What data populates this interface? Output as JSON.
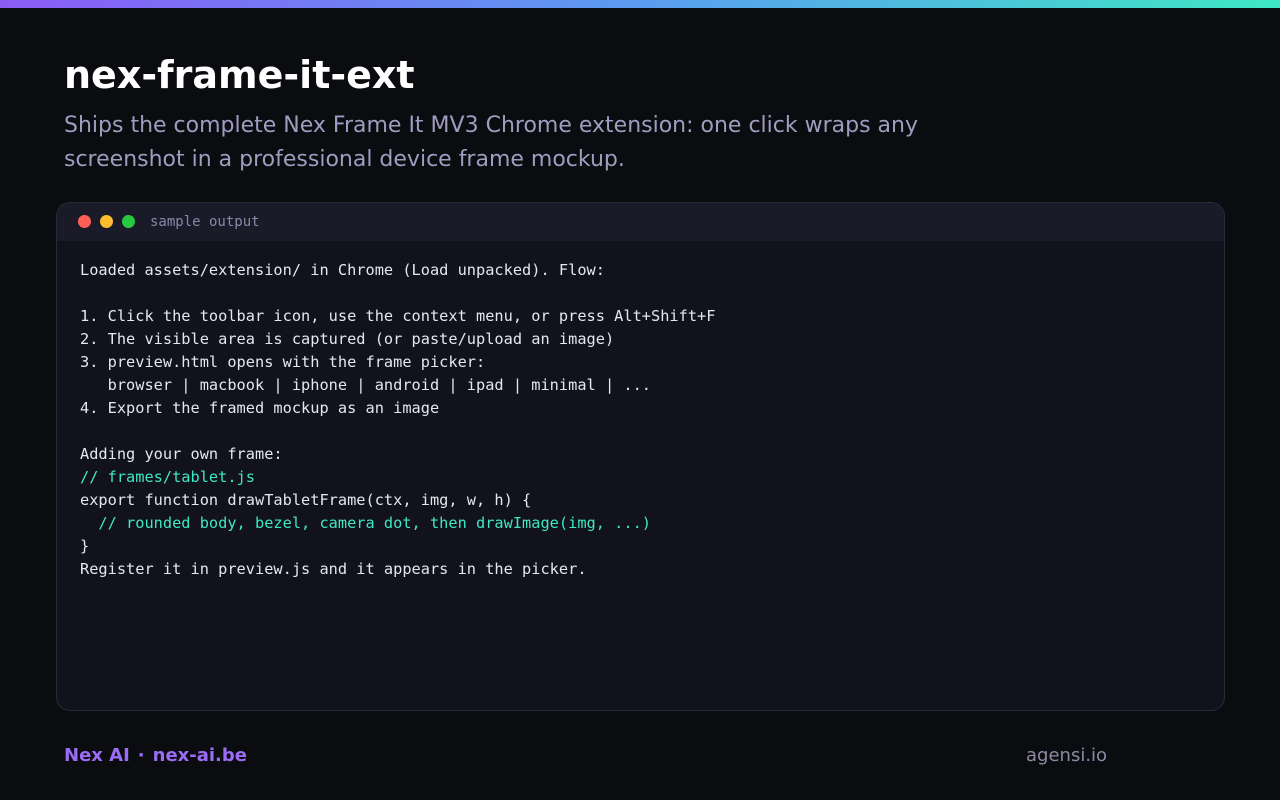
{
  "page": {
    "title": "nex-frame-it-ext",
    "subtitle": "Ships the complete Nex Frame It MV3 Chrome extension: one click wraps any screenshot in a professional device frame mockup."
  },
  "window": {
    "label": "sample output",
    "dots": [
      "red",
      "yellow",
      "green"
    ]
  },
  "code_lines": [
    {
      "text": "Loaded assets/extension/ in Chrome (Load unpacked). Flow:",
      "kind": "text"
    },
    {
      "text": "",
      "kind": "text"
    },
    {
      "text": "1. Click the toolbar icon, use the context menu, or press Alt+Shift+F",
      "kind": "text"
    },
    {
      "text": "2. The visible area is captured (or paste/upload an image)",
      "kind": "text"
    },
    {
      "text": "3. preview.html opens with the frame picker:",
      "kind": "text"
    },
    {
      "text": "   browser | macbook | iphone | android | ipad | minimal | ...",
      "kind": "text"
    },
    {
      "text": "4. Export the framed mockup as an image",
      "kind": "text"
    },
    {
      "text": "",
      "kind": "text"
    },
    {
      "text": "Adding your own frame:",
      "kind": "text"
    },
    {
      "text": "// frames/tablet.js",
      "kind": "comment"
    },
    {
      "text": "export function drawTabletFrame(ctx, img, w, h) {",
      "kind": "text"
    },
    {
      "text": "  // rounded body, bezel, camera dot, then drawImage(img, ...)",
      "kind": "comment"
    },
    {
      "text": "}",
      "kind": "text"
    },
    {
      "text": "Register it in preview.js and it appears in the picker.",
      "kind": "text"
    }
  ],
  "footer": {
    "brand": "Nex AI",
    "separator": "·",
    "site": "nex-ai.be",
    "right": "agensi.io"
  },
  "colors": {
    "background": "#0b0c10",
    "accent_purple": "#9b6cf5",
    "comment_teal": "#3ee8c4",
    "gradient_start": "#8b5cf6",
    "gradient_end": "#3ee8c4"
  }
}
